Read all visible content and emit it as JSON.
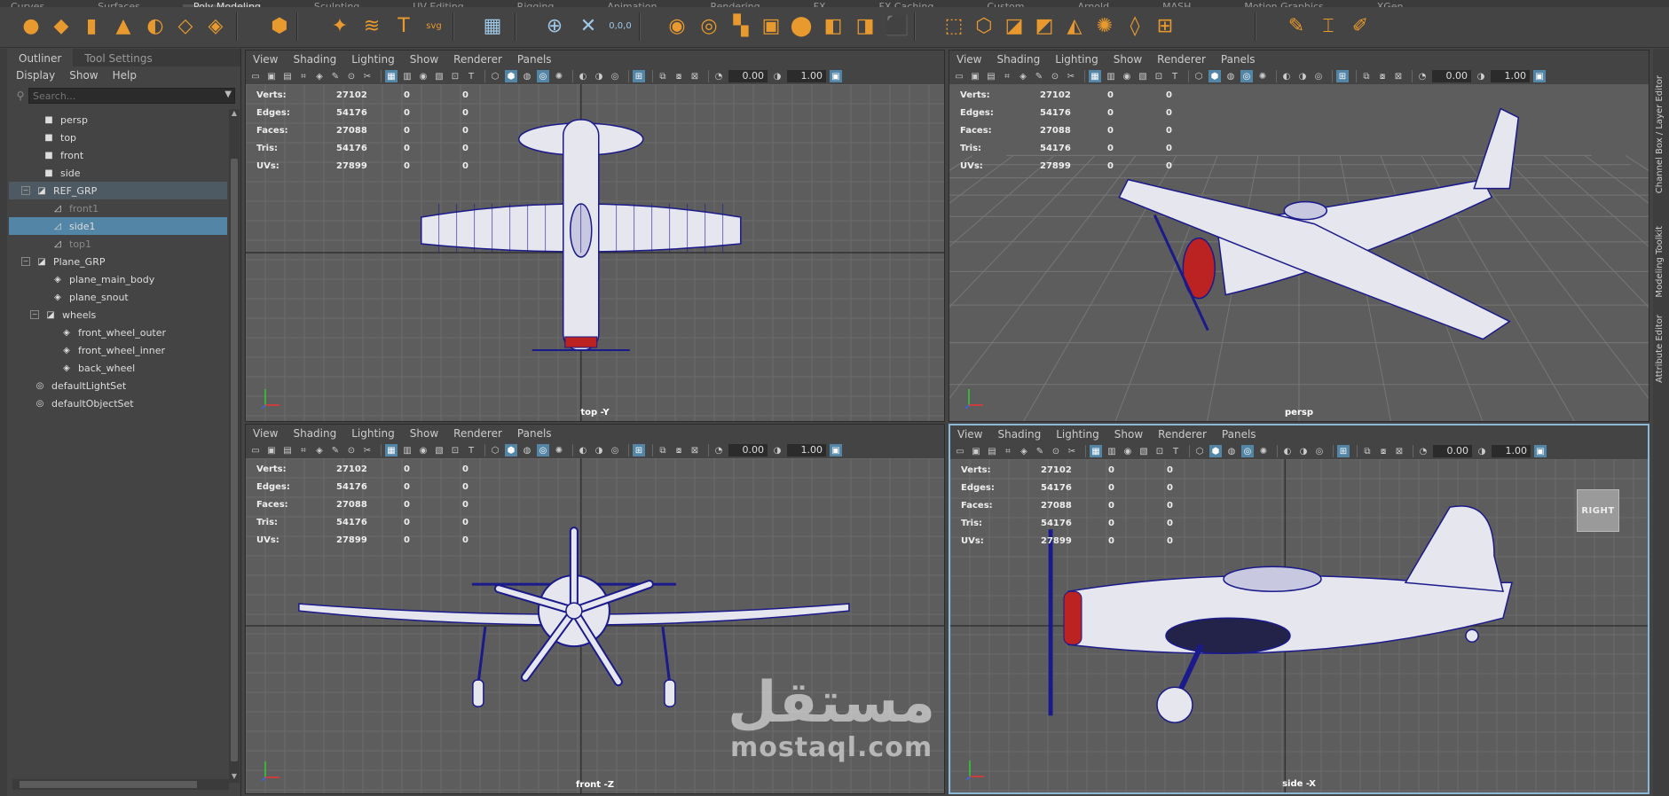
{
  "shelf_tabs": [
    "Curves",
    "Surfaces",
    "Poly Modeling",
    "Sculpting",
    "UV Editing",
    "Rigging",
    "Animation",
    "Rendering",
    "FX",
    "FX Caching",
    "Custom",
    "Arnold",
    "MASH",
    "Motion Graphics",
    "XGen"
  ],
  "shelf_active": "Poly Modeling",
  "shelf_icons": [
    {
      "name": "poly-sphere-icon",
      "glyph": "●"
    },
    {
      "name": "poly-cube-icon",
      "glyph": "◆"
    },
    {
      "name": "poly-cylinder-icon",
      "glyph": "▮"
    },
    {
      "name": "poly-cone-icon",
      "glyph": "▲"
    },
    {
      "name": "poly-torus-icon",
      "glyph": "◐"
    },
    {
      "name": "poly-plane-icon",
      "glyph": "◇"
    },
    {
      "name": "poly-disc-icon",
      "glyph": "◈"
    },
    {
      "name": "platonic-solid-icon",
      "glyph": "⬢"
    },
    {
      "name": "super-shape-icon",
      "glyph": "✦"
    },
    {
      "name": "sweep-mesh-icon",
      "glyph": "≋"
    },
    {
      "name": "type-icon",
      "glyph": "T"
    },
    {
      "name": "svg-icon",
      "glyph": "svg"
    },
    {
      "name": "poly-count-icon",
      "glyph": "▦"
    },
    {
      "name": "snap-pivot-icon",
      "glyph": "⊕"
    },
    {
      "name": "transform-icon",
      "glyph": "✕"
    },
    {
      "name": "coordinates-icon",
      "glyph": "0,0,0"
    },
    {
      "name": "combine-icon",
      "glyph": "◉"
    },
    {
      "name": "separate-icon",
      "glyph": "◎"
    },
    {
      "name": "extract-icon",
      "glyph": "▚"
    },
    {
      "name": "boolean-icon",
      "glyph": "▣"
    },
    {
      "name": "smooth-icon",
      "glyph": "⬤"
    },
    {
      "name": "reduce-icon",
      "glyph": "◧"
    },
    {
      "name": "mirror-icon",
      "glyph": "◨"
    },
    {
      "name": "extrude-icon",
      "glyph": "⬛"
    },
    {
      "name": "bridge-icon",
      "glyph": "⬚"
    },
    {
      "name": "bevel-icon",
      "glyph": "⬡"
    },
    {
      "name": "fill-hole-icon",
      "glyph": "◪"
    },
    {
      "name": "append-icon",
      "glyph": "◩"
    },
    {
      "name": "wedge-icon",
      "glyph": "◭"
    },
    {
      "name": "poke-icon",
      "glyph": "✺"
    },
    {
      "name": "collapse-icon",
      "glyph": "◊"
    },
    {
      "name": "connect-icon",
      "glyph": "⊞"
    },
    {
      "name": "multi-cut-icon",
      "glyph": "✎"
    },
    {
      "name": "target-weld-icon",
      "glyph": "⌶"
    },
    {
      "name": "quad-draw-icon",
      "glyph": "✐"
    }
  ],
  "outliner": {
    "tabs": [
      "Outliner",
      "Tool Settings"
    ],
    "menu": [
      "Display",
      "Show",
      "Help"
    ],
    "search_placeholder": "Search...",
    "items": [
      {
        "label": "persp",
        "icon": "camera-icon",
        "glyph": "■",
        "indent": 1,
        "state": ""
      },
      {
        "label": "top",
        "icon": "camera-icon",
        "glyph": "■",
        "indent": 1,
        "state": ""
      },
      {
        "label": "front",
        "icon": "camera-icon",
        "glyph": "■",
        "indent": 1,
        "state": ""
      },
      {
        "label": "side",
        "icon": "camera-icon",
        "glyph": "■",
        "indent": 1,
        "state": ""
      },
      {
        "label": "REF_GRP",
        "icon": "group-icon",
        "glyph": "◪",
        "indent": 0,
        "state": "grp",
        "expand": "−"
      },
      {
        "label": "front1",
        "icon": "image-plane-icon",
        "glyph": "◿",
        "indent": 2,
        "state": "dim"
      },
      {
        "label": "side1",
        "icon": "image-plane-icon",
        "glyph": "◿",
        "indent": 2,
        "state": "sel"
      },
      {
        "label": "top1",
        "icon": "image-plane-icon",
        "glyph": "◿",
        "indent": 2,
        "state": "dim"
      },
      {
        "label": "Plane_GRP",
        "icon": "group-icon",
        "glyph": "◪",
        "indent": 0,
        "state": "",
        "expand": "−"
      },
      {
        "label": "plane_main_body",
        "icon": "mesh-icon",
        "glyph": "◈",
        "indent": 2,
        "state": ""
      },
      {
        "label": "plane_snout",
        "icon": "mesh-icon",
        "glyph": "◈",
        "indent": 2,
        "state": ""
      },
      {
        "label": "wheels",
        "icon": "group-icon",
        "glyph": "◪",
        "indent": 1,
        "state": "",
        "expand": "−"
      },
      {
        "label": "front_wheel_outer",
        "icon": "mesh-icon",
        "glyph": "◈",
        "indent": 3,
        "state": ""
      },
      {
        "label": "front_wheel_inner",
        "icon": "mesh-icon",
        "glyph": "◈",
        "indent": 3,
        "state": ""
      },
      {
        "label": "back_wheel",
        "icon": "mesh-icon",
        "glyph": "◈",
        "indent": 3,
        "state": ""
      },
      {
        "label": "defaultLightSet",
        "icon": "set-icon",
        "glyph": "◎",
        "indent": 0,
        "state": ""
      },
      {
        "label": "defaultObjectSet",
        "icon": "set-icon",
        "glyph": "◎",
        "indent": 0,
        "state": ""
      }
    ]
  },
  "panel_menu": [
    "View",
    "Shading",
    "Lighting",
    "Show",
    "Renderer",
    "Panels"
  ],
  "toolbar_values": {
    "exposure": "0.00",
    "gamma": "1.00"
  },
  "hud_labels": [
    "Verts:",
    "Edges:",
    "Faces:",
    "Tris:",
    "UVs:"
  ],
  "hud_values": [
    "27102",
    "54176",
    "27088",
    "54176",
    "27899"
  ],
  "hud_zero": "0",
  "panels": {
    "top": {
      "camera": "top -Y"
    },
    "persp": {
      "camera": "persp"
    },
    "front": {
      "camera": "front -Z"
    },
    "side": {
      "camera": "side -X"
    }
  },
  "viewcube_label": "RIGHT",
  "right_tabs": [
    "Channel Box / Layer Editor",
    "Modeling Toolkit",
    "Attribute Editor"
  ],
  "watermark": {
    "arabic": "مستقل",
    "latin": "mostaql.com"
  },
  "colors": {
    "accent": "#5285a6",
    "wire": "#1a1a8a",
    "shelf_orange": "#e89a2e"
  }
}
